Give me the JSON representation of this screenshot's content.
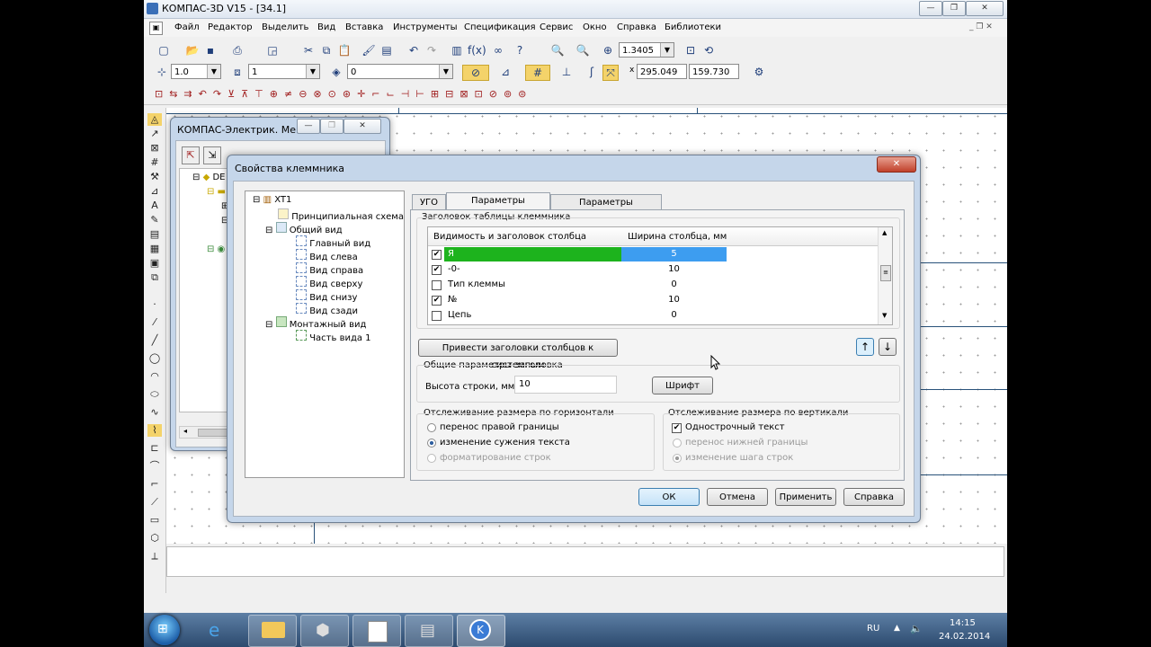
{
  "app": {
    "title": "КОМПАС-3D V15 - [З4.1]",
    "menu": [
      "Файл",
      "Редактор",
      "Выделить",
      "Вид",
      "Вставка",
      "Инструменты",
      "Спецификация",
      "Сервис",
      "Окно",
      "Справка",
      "Библиотеки"
    ],
    "zoom_value": "1.3405",
    "style_width": "1.0",
    "layer_value": "1",
    "state_value": "0",
    "coord_x": "295.049",
    "coord_y": "159.730"
  },
  "bg_window": {
    "title": "КОМПАС-Электрик. Ме...",
    "tree_root": "DE"
  },
  "dialog": {
    "title": "Свойства клеммника",
    "tree": {
      "root": "XT1",
      "items": [
        {
          "label": "Принципиальная схема"
        },
        {
          "label": "Общий вид"
        },
        {
          "label": "Главный вид"
        },
        {
          "label": "Вид слева"
        },
        {
          "label": "Вид справа"
        },
        {
          "label": "Вид сверху"
        },
        {
          "label": "Вид снизу"
        },
        {
          "label": "Вид сзади"
        },
        {
          "label": "Монтажный вид"
        },
        {
          "label": "Часть вида 1"
        }
      ]
    },
    "tabs": [
      "УГО",
      "Параметры заголовка",
      "Параметры содержания"
    ],
    "header_group_label": "Заголовок таблицы клеммника",
    "table": {
      "col1": "Видимость и заголовок столбца",
      "col2": "Ширина столбца, мм",
      "rows": [
        {
          "checked": true,
          "name": "Я",
          "width": "5"
        },
        {
          "checked": true,
          "name": "-0-",
          "width": "10"
        },
        {
          "checked": false,
          "name": "Тип клеммы",
          "width": "0"
        },
        {
          "checked": true,
          "name": "№",
          "width": "10"
        },
        {
          "checked": false,
          "name": "Цепь",
          "width": "0"
        }
      ]
    },
    "reset_button": "Привести заголовки столбцов к системным",
    "common_group_label": "Общие параметры заголовка",
    "row_height_label": "Высота строки, мм",
    "row_height_value": "10",
    "font_button": "Шрифт",
    "horiz_group": {
      "label": "Отслеживание размера по горизонтали",
      "options": [
        "перенос правой границы",
        "изменение сужения текста",
        "форматирование строк"
      ]
    },
    "vert_group": {
      "label": "Отслеживание размера по вертикали",
      "single_line": "Однострочный текст",
      "options": [
        "перенос нижней границы",
        "изменение шага строк"
      ]
    },
    "buttons": {
      "ok": "ОК",
      "cancel": "Отмена",
      "apply": "Применить",
      "help": "Справка"
    }
  },
  "tray": {
    "lang": "RU",
    "time": "14:15",
    "date": "24.02.2014"
  },
  "colors": {
    "selected_row_name_bg": "#1db31d",
    "selected_row_width_bg": "#3d9df0"
  }
}
